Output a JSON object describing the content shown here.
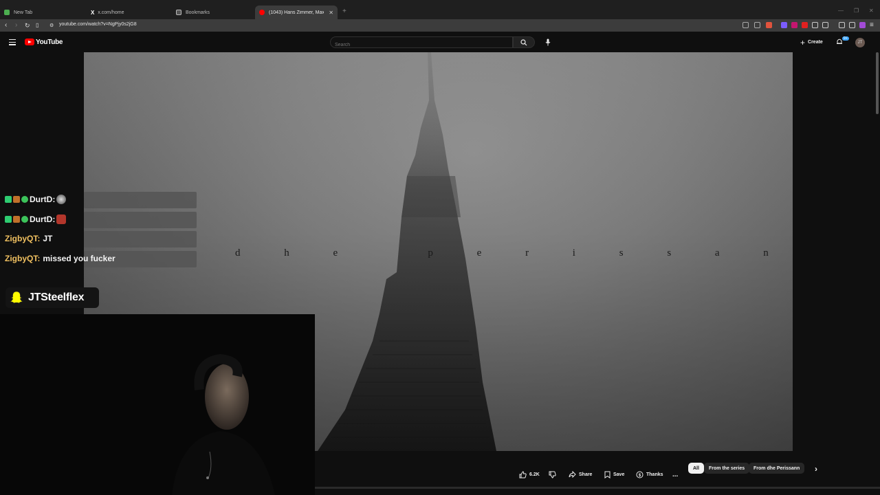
{
  "browser": {
    "tabs": [
      {
        "title": "New Tab",
        "icon": "grid-icon",
        "color": "#4caf50"
      },
      {
        "title": "x.com/home",
        "icon": "x-logo-icon",
        "color": "#ffffff"
      },
      {
        "title": "Bookmarks",
        "icon": "bookmark-icon",
        "color": "#bbbbbb"
      },
      {
        "title": "(1043) Hans Zimmer, Max Ri...",
        "icon": "youtube-icon",
        "color": "#ff0000"
      }
    ],
    "new_tab_label": "+",
    "url": "youtube.com/watch?v=NgPjy0s2jG8"
  },
  "youtube": {
    "logo_text": "YouTube",
    "search_placeholder": "Search",
    "create_label": "Create",
    "notification_count": "9+",
    "avatar_initials": "JT"
  },
  "video": {
    "overlay_text": "d h e   p e r i s s a n n"
  },
  "stream_chat": [
    {
      "user": "DurtD:",
      "message": "",
      "user_color": "#f5f5f5"
    },
    {
      "user": "DurtD:",
      "message": "",
      "user_color": "#f5f5f5"
    },
    {
      "user": "ZigbyQT:",
      "message": "JT",
      "user_color": "#f0c060"
    },
    {
      "user": "ZigbyQT:",
      "message": "missed you fucker",
      "user_color": "#f0c060"
    }
  ],
  "snapchat_handle": "JTSteelflex",
  "action_bar": {
    "likes": "6.2K",
    "share_label": "Share",
    "save_label": "Save",
    "thanks_label": "Thanks",
    "more_label": "...",
    "chips": [
      "All",
      "From the series",
      "From dhe Perissann"
    ],
    "next_icon": "chevron-right-icon"
  }
}
